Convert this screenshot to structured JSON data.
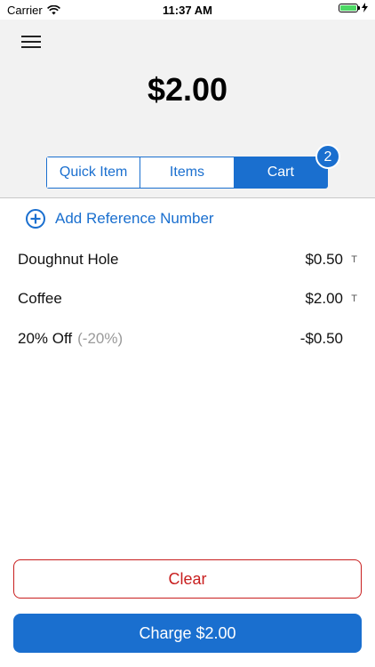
{
  "status": {
    "carrier": "Carrier",
    "time": "11:37 AM",
    "battery_level": 1.0,
    "charging": true
  },
  "header": {
    "total": "$2.00"
  },
  "tabs": [
    {
      "label": "Quick Item",
      "active": false
    },
    {
      "label": "Items",
      "active": false
    },
    {
      "label": "Cart",
      "active": true
    }
  ],
  "cart_badge": "2",
  "reference": {
    "label": "Add Reference Number"
  },
  "line_items": [
    {
      "name": "Doughnut Hole",
      "note": "",
      "price": "$0.50",
      "tax": "T"
    },
    {
      "name": "Coffee",
      "note": "",
      "price": "$2.00",
      "tax": "T"
    },
    {
      "name": "20% Off",
      "note": "(-20%)",
      "price": "-$0.50",
      "tax": ""
    }
  ],
  "buttons": {
    "clear": "Clear",
    "charge": "Charge $2.00"
  },
  "colors": {
    "accent": "#1a6fcf",
    "danger": "#c81e1e",
    "header_bg": "#f2f2f2"
  }
}
